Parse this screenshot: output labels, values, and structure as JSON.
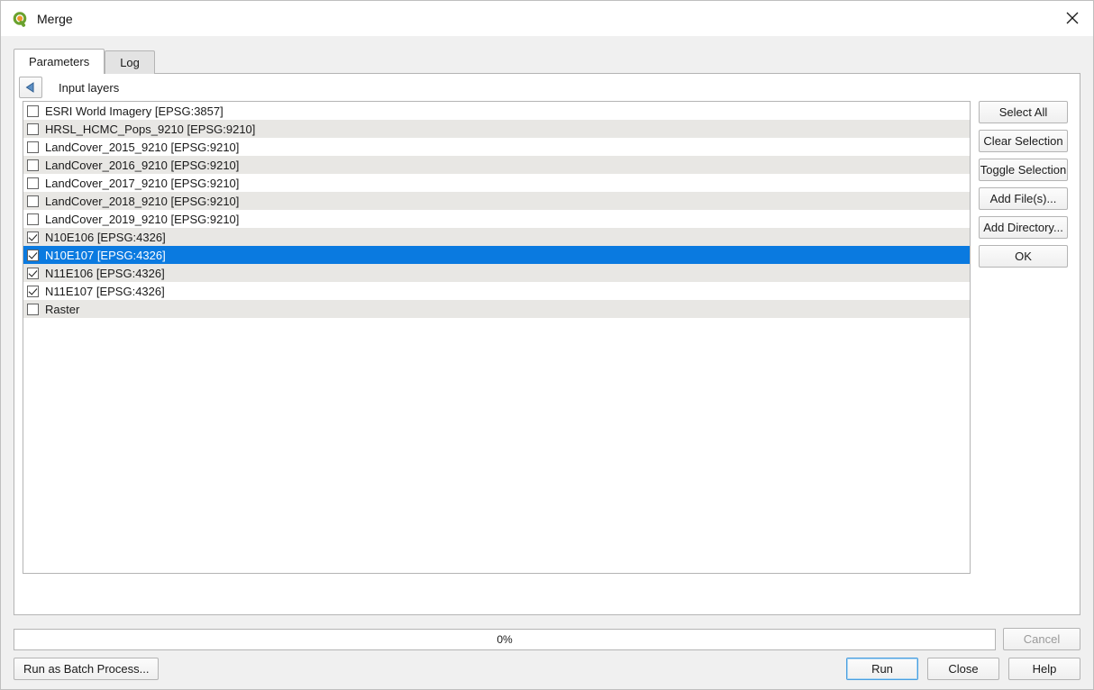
{
  "window": {
    "title": "Merge",
    "app_icon": "qgis-logo-icon",
    "close_icon": "close-icon"
  },
  "tabs": [
    {
      "label": "Parameters",
      "active": true
    },
    {
      "label": "Log",
      "active": false
    }
  ],
  "panel": {
    "back_icon": "back-arrow-icon",
    "header_label": "Input layers"
  },
  "layers": [
    {
      "label": "ESRI World Imagery [EPSG:3857]",
      "checked": false,
      "selected": false
    },
    {
      "label": "HRSL_HCMC_Pops_9210 [EPSG:9210]",
      "checked": false,
      "selected": false
    },
    {
      "label": "LandCover_2015_9210 [EPSG:9210]",
      "checked": false,
      "selected": false
    },
    {
      "label": "LandCover_2016_9210 [EPSG:9210]",
      "checked": false,
      "selected": false
    },
    {
      "label": "LandCover_2017_9210 [EPSG:9210]",
      "checked": false,
      "selected": false
    },
    {
      "label": "LandCover_2018_9210 [EPSG:9210]",
      "checked": false,
      "selected": false
    },
    {
      "label": "LandCover_2019_9210 [EPSG:9210]",
      "checked": false,
      "selected": false
    },
    {
      "label": "N10E106 [EPSG:4326]",
      "checked": true,
      "selected": false
    },
    {
      "label": "N10E107 [EPSG:4326]",
      "checked": true,
      "selected": true
    },
    {
      "label": "N11E106 [EPSG:4326]",
      "checked": true,
      "selected": false
    },
    {
      "label": "N11E107 [EPSG:4326]",
      "checked": true,
      "selected": false
    },
    {
      "label": "Raster",
      "checked": false,
      "selected": false
    }
  ],
  "side_buttons": [
    {
      "label": "Select All",
      "name": "select-all-button"
    },
    {
      "label": "Clear Selection",
      "name": "clear-selection-button"
    },
    {
      "label": "Toggle Selection",
      "name": "toggle-selection-button"
    },
    {
      "label": "Add File(s)...",
      "name": "add-files-button"
    },
    {
      "label": "Add Directory...",
      "name": "add-directory-button"
    },
    {
      "label": "OK",
      "name": "ok-button"
    }
  ],
  "progress": {
    "text": "0%",
    "value": 0
  },
  "footer": {
    "cancel_label": "Cancel",
    "cancel_disabled": true,
    "batch_label": "Run as Batch Process...",
    "run_label": "Run",
    "close_label": "Close",
    "help_label": "Help"
  },
  "colors": {
    "selection_blue": "#0a7ae0",
    "alt_row": "#e8e7e4",
    "dialog_bg": "#f0f0f0",
    "focus_blue": "#4a9fe0",
    "logo_green": "#6aa22e",
    "logo_orange": "#f0932a"
  }
}
